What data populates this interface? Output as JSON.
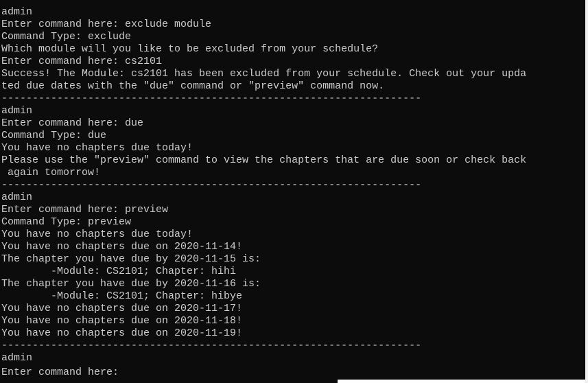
{
  "terminal": {
    "lines": [
      "--------------------------------------------------------------------",
      "admin",
      "Enter command here: exclude module",
      "Command Type: exclude",
      "Which module will you like to be excluded from your schedule?",
      "Enter command here: cs2101",
      "Success! The Module: cs2101 has been excluded from your schedule. Check out your upda",
      "ted due dates with the \"due\" command or \"preview\" command now.",
      "--------------------------------------------------------------------",
      "admin",
      "Enter command here: due",
      "Command Type: due",
      "You have no chapters due today!",
      "Please use the \"preview\" command to view the chapters that are due soon or check back",
      " again tomorrow!",
      "--------------------------------------------------------------------",
      "admin",
      "Enter command here: preview",
      "Command Type: preview",
      "You have no chapters due today!",
      "You have no chapters due on 2020-11-14!",
      "The chapter you have due by 2020-11-15 is:",
      "        -Module: CS2101; Chapter: hihi",
      "The chapter you have due by 2020-11-16 is:",
      "        -Module: CS2101; Chapter: hibye",
      "You have no chapters due on 2020-11-17!",
      "You have no chapters due on 2020-11-18!",
      "You have no chapters due on 2020-11-19!",
      "--------------------------------------------------------------------",
      "admin",
      "Enter command here: "
    ]
  },
  "colors": {
    "background": "#0c0c0c",
    "foreground": "#cccccc"
  }
}
